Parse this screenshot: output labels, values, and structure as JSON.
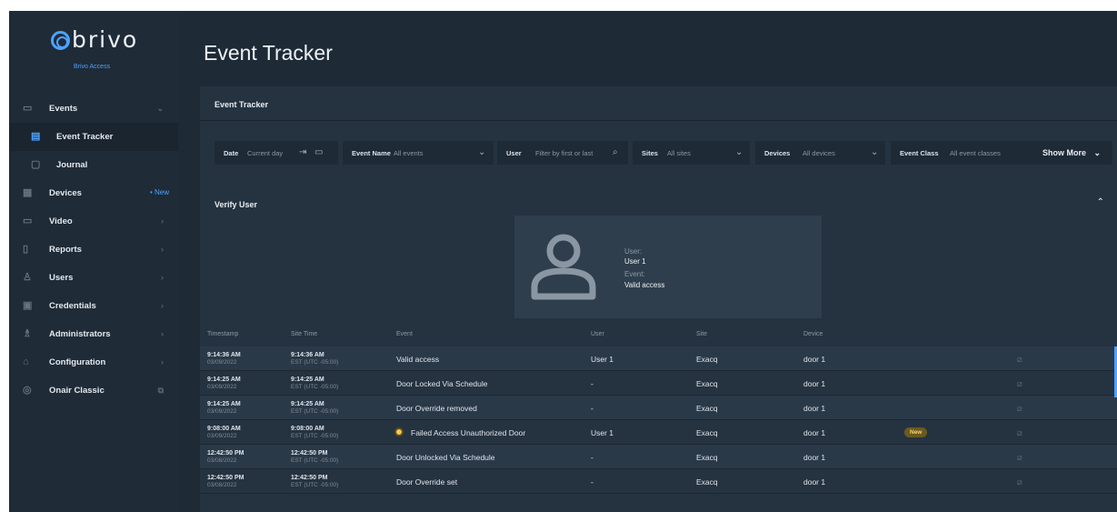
{
  "brand": {
    "name": "brivo",
    "subtitle": "Brivo Access"
  },
  "sidebar": {
    "items": [
      {
        "label": "Events",
        "icon": "chat-icon",
        "chev": "⌄"
      },
      {
        "label": "Event Tracker",
        "icon": "list-icon"
      },
      {
        "label": "Journal",
        "icon": "journal-icon"
      },
      {
        "label": "Devices",
        "icon": "devices-icon",
        "badge": "• New"
      },
      {
        "label": "Video",
        "icon": "video-icon",
        "chev": "›"
      },
      {
        "label": "Reports",
        "icon": "reports-icon",
        "chev": "›"
      },
      {
        "label": "Users",
        "icon": "user-icon",
        "chev": "›"
      },
      {
        "label": "Credentials",
        "icon": "credential-icon",
        "chev": "›"
      },
      {
        "label": "Administrators",
        "icon": "admin-icon",
        "chev": "›"
      },
      {
        "label": "Configuration",
        "icon": "config-icon",
        "chev": "›"
      },
      {
        "label": "Onair Classic",
        "icon": "onair-icon",
        "chev": "⧉"
      }
    ]
  },
  "page": {
    "title": "Event Tracker",
    "panel_title": "Event Tracker"
  },
  "filters": {
    "date": {
      "label": "Date",
      "value": "Current day"
    },
    "event_name": {
      "label": "Event Name",
      "value": "All events"
    },
    "user": {
      "label": "User",
      "placeholder": "Filter by first or last"
    },
    "sites": {
      "label": "Sites",
      "value": "All sites"
    },
    "devices": {
      "label": "Devices",
      "value": "All devices"
    },
    "event_class": {
      "label": "Event Class",
      "value": "All event classes"
    },
    "show_more": "Show More"
  },
  "verify": {
    "title": "Verify User",
    "user_label": "User:",
    "user_value": "User 1",
    "event_label": "Event:",
    "event_value": "Valid access"
  },
  "columns": [
    "Timestamp",
    "Site Time",
    "Event",
    "User",
    "Site",
    "Device"
  ],
  "rows": [
    {
      "time": "9:14:36 AM",
      "date": "03/09/2022",
      "site_time": "9:14:36 AM",
      "tz": "EST (UTC -05:00)",
      "event": "Valid access",
      "user": "User 1",
      "site": "Exacq",
      "device": "door 1"
    },
    {
      "time": "9:14:25 AM",
      "date": "03/09/2022",
      "site_time": "9:14:25 AM",
      "tz": "EST (UTC -05:00)",
      "event": "Door Locked Via Schedule",
      "user": "-",
      "site": "Exacq",
      "device": "door 1"
    },
    {
      "time": "9:14:25 AM",
      "date": "03/09/2022",
      "site_time": "9:14:25 AM",
      "tz": "EST (UTC -05:00)",
      "event": "Door Override removed",
      "user": "-",
      "site": "Exacq",
      "device": "door 1"
    },
    {
      "time": "9:08:00 AM",
      "date": "03/09/2022",
      "site_time": "9:08:00 AM",
      "tz": "EST (UTC -05:00)",
      "event": "Failed Access Unauthorized Door",
      "user": "User 1",
      "site": "Exacq",
      "device": "door 1",
      "badge": "New"
    },
    {
      "time": "12:42:50 PM",
      "date": "03/08/2022",
      "site_time": "12:42:50 PM",
      "tz": "EST (UTC -05:00)",
      "event": "Door Unlocked Via Schedule",
      "user": "-",
      "site": "Exacq",
      "device": "door 1"
    },
    {
      "time": "12:42:50 PM",
      "date": "03/08/2022",
      "site_time": "12:42:50 PM",
      "tz": "EST (UTC -05:00)",
      "event": "Door Override set",
      "user": "-",
      "site": "Exacq",
      "device": "door 1"
    }
  ],
  "colors": {
    "accent": "#4da3ff",
    "warning": "#f2c94c"
  }
}
